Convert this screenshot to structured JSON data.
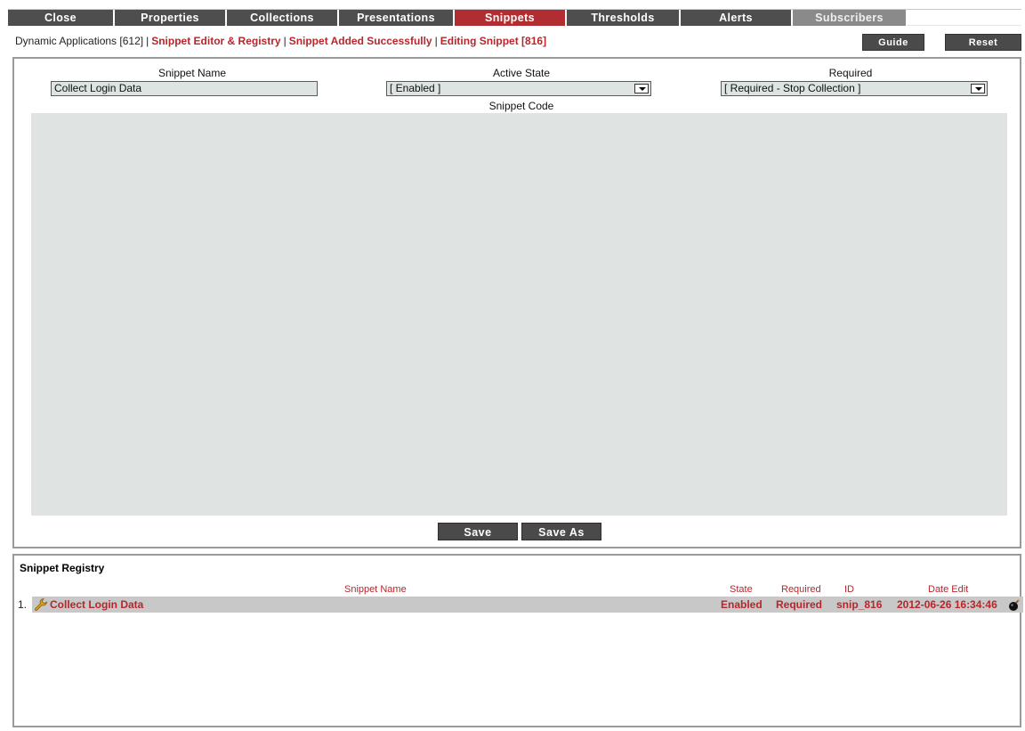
{
  "tabs": [
    {
      "label": "Close",
      "state": "normal"
    },
    {
      "label": "Properties",
      "state": "normal"
    },
    {
      "label": "Collections",
      "state": "normal"
    },
    {
      "label": "Presentations",
      "state": "normal"
    },
    {
      "label": "Snippets",
      "state": "active"
    },
    {
      "label": "Thresholds",
      "state": "normal"
    },
    {
      "label": "Alerts",
      "state": "normal"
    },
    {
      "label": "Subscribers",
      "state": "disabled"
    }
  ],
  "breadcrumb": {
    "root": "Dynamic Applications [612]",
    "section": "Snippet Editor & Registry",
    "status": "Snippet Added Successfully",
    "editing": "Editing Snippet [816]"
  },
  "header_buttons": {
    "guide": "Guide",
    "reset": "Reset"
  },
  "editor": {
    "snippet_name_label": "Snippet Name",
    "snippet_name_value": "Collect Login Data",
    "active_state_label": "Active State",
    "active_state_value": "[ Enabled ]",
    "required_label": "Required",
    "required_value": "[ Required - Stop Collection ]",
    "snippet_code_label": "Snippet Code",
    "snippet_code_value": "",
    "save_label": "Save",
    "save_as_label": "Save As"
  },
  "registry": {
    "title": "Snippet Registry",
    "columns": {
      "name": "Snippet Name",
      "state": "State",
      "required": "Required",
      "id": "ID",
      "date_edit": "Date Edit"
    },
    "rows": [
      {
        "index": "1.",
        "name": "Collect Login Data",
        "state": "Enabled",
        "required": "Required",
        "id": "snip_816",
        "date_edit": "2012-06-26 16:34:46"
      }
    ]
  },
  "colors": {
    "tab_bg": "#4e4e4e",
    "tab_active_bg": "#b22d32",
    "tab_disabled_bg": "#8a8a8a",
    "accent_red": "#b8262b",
    "field_bg": "#dde4e2",
    "row_bg": "#c8c8c8"
  }
}
